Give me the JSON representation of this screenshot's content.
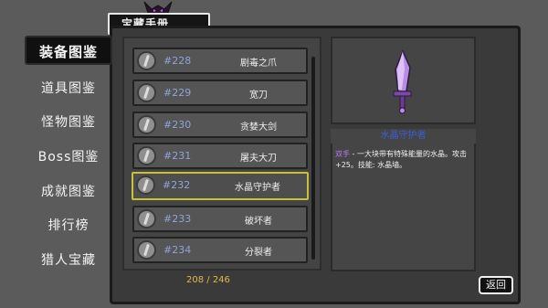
{
  "header": {
    "title": "宝藏手册"
  },
  "sidebar": {
    "items": [
      {
        "label": "装备图鉴",
        "active": true
      },
      {
        "label": "道具图鉴"
      },
      {
        "label": "怪物图鉴"
      },
      {
        "label": "Boss图鉴"
      },
      {
        "label": "成就图鉴"
      },
      {
        "label": "排行榜"
      },
      {
        "label": "猎人宝藏"
      }
    ]
  },
  "list": {
    "rows": [
      {
        "num": "#228",
        "name": "剧毒之爪"
      },
      {
        "num": "#229",
        "name": "宽刀"
      },
      {
        "num": "#230",
        "name": "贪婪大剑"
      },
      {
        "num": "#231",
        "name": "屠夫大刀"
      },
      {
        "num": "#232",
        "name": "水晶守护者",
        "selected": true
      },
      {
        "num": "#233",
        "name": "破坏者"
      },
      {
        "num": "#234",
        "name": "分裂者"
      }
    ],
    "count": "208 / 246"
  },
  "detail": {
    "title": "水晶守护者",
    "tag": "双手",
    "text": " - 一大块带有特殊能量的水晶。攻击+25。技能: 水晶墙。"
  },
  "buttons": {
    "back": "返回"
  },
  "colors": {
    "selected_border": "#c9c237",
    "count": "#e2b84a",
    "number": "#8fa3d6",
    "crystal": "#b98be3"
  },
  "icons": {
    "crest": "demon-crest-icon",
    "item": "weapon-icon"
  }
}
